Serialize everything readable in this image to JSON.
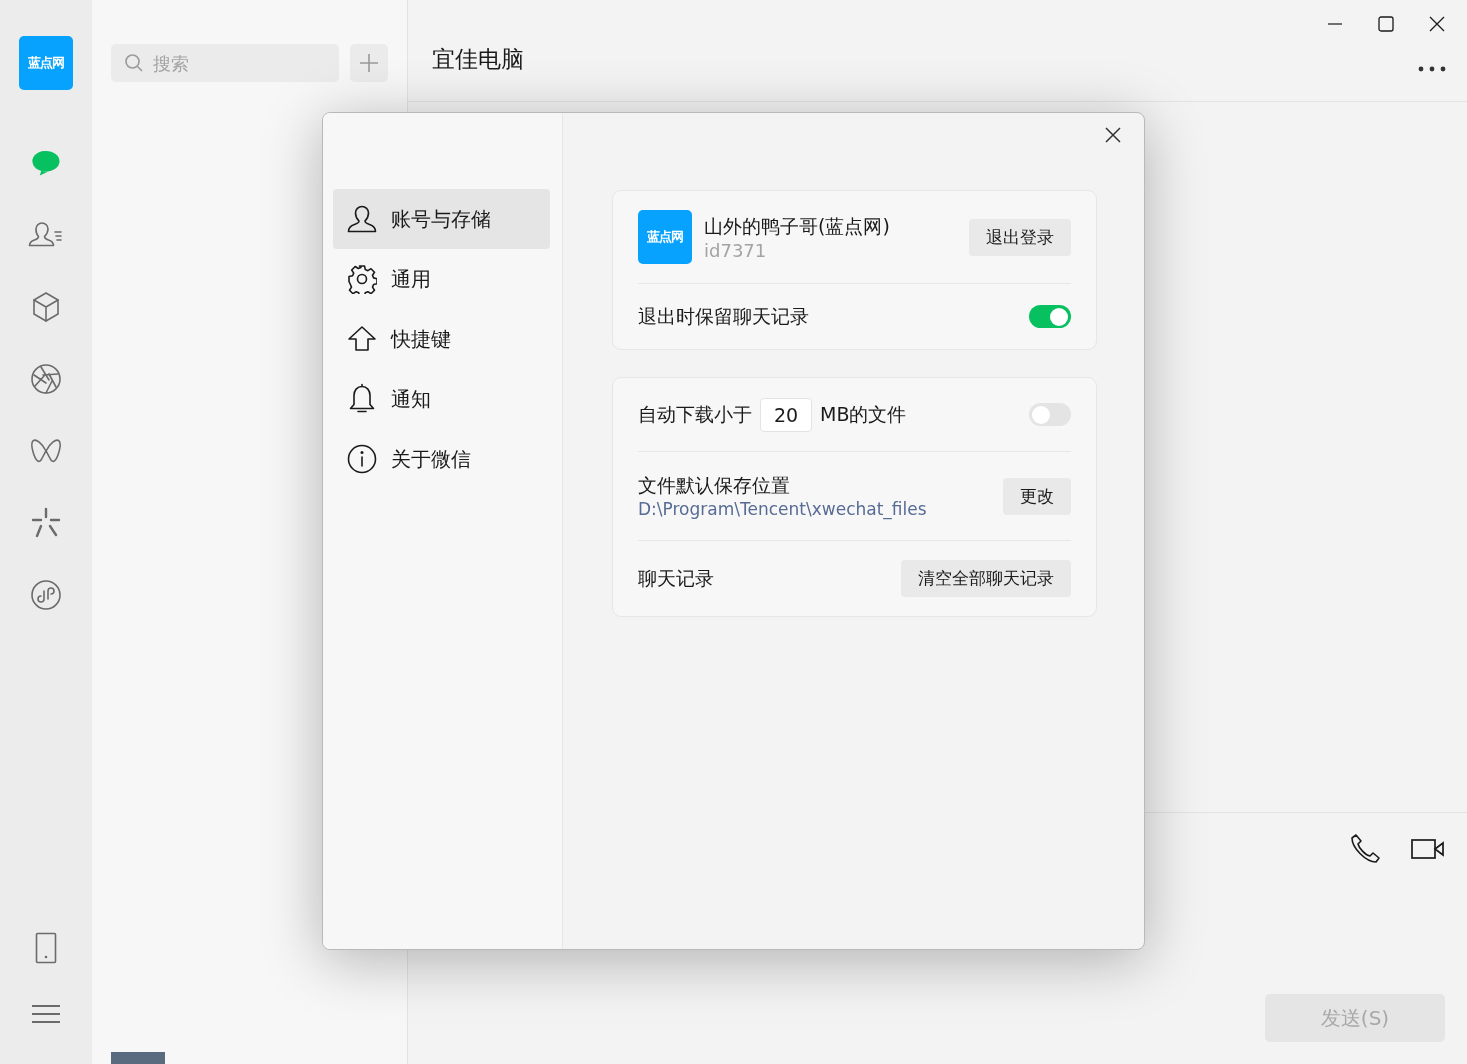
{
  "nav": {
    "logo": "蓝点网",
    "items": [
      {
        "kind": "chat",
        "selected": true
      },
      {
        "kind": "contacts",
        "selected": false
      },
      {
        "kind": "cube",
        "selected": false
      },
      {
        "kind": "aperture",
        "selected": false
      },
      {
        "kind": "butterfly",
        "selected": false
      },
      {
        "kind": "sparkle",
        "selected": false
      },
      {
        "kind": "miniprogram",
        "selected": false
      }
    ],
    "bottom_items": [
      {
        "kind": "phone"
      },
      {
        "kind": "menu"
      }
    ]
  },
  "search": {
    "placeholder": "搜索"
  },
  "chat": {
    "title": "宜佳电脑",
    "send_button": "发送(S)"
  },
  "dialog": {
    "menu": [
      {
        "kind": "person",
        "label": "账号与存储",
        "selected": true
      },
      {
        "kind": "gear",
        "label": "通用",
        "selected": false
      },
      {
        "kind": "arrow",
        "label": "快捷键",
        "selected": false
      },
      {
        "kind": "bell",
        "label": "通知",
        "selected": false
      },
      {
        "kind": "info",
        "label": "关于微信",
        "selected": false
      }
    ],
    "account": {
      "avatar_text": "蓝点网",
      "name": "山外的鸭子哥(蓝点网)",
      "id": "id7371",
      "logout_button": "退出登录"
    },
    "keep_history": {
      "label": "退出时保留聊天记录",
      "on": true
    },
    "auto_download": {
      "label_before": "自动下载小于",
      "value": "20",
      "label_after": "MB的文件",
      "on": false
    },
    "save_location": {
      "label": "文件默认保存位置",
      "path": "D:\\Program\\Tencent\\xwechat_files",
      "button": "更改"
    },
    "chat_history": {
      "label": "聊天记录",
      "button": "清空全部聊天记录"
    }
  }
}
